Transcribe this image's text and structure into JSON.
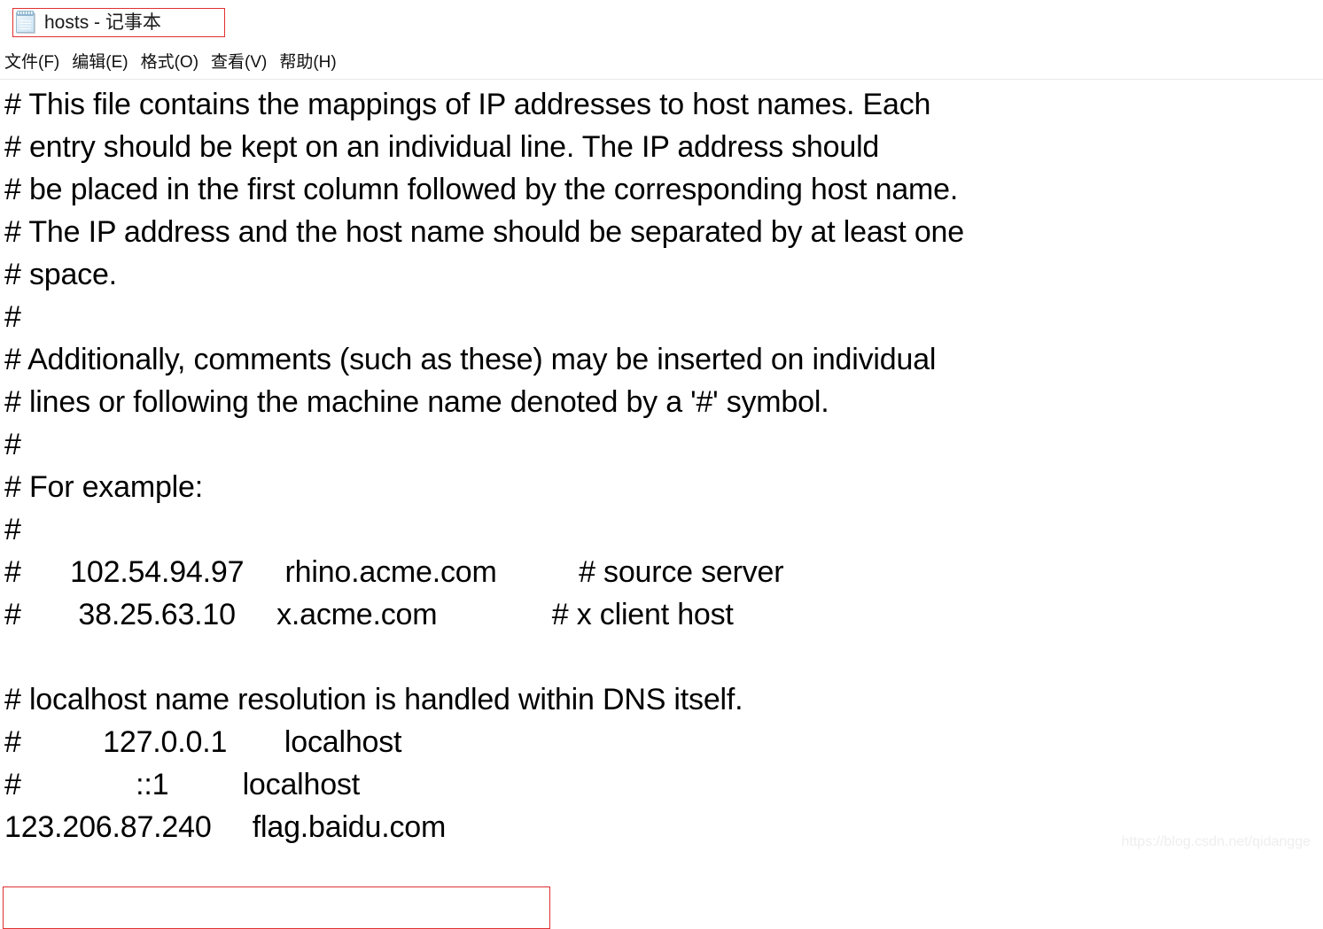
{
  "window": {
    "title": "hosts - 记事本",
    "icon": "notepad-icon",
    "title_highlight_color": "#e03030"
  },
  "menubar": {
    "items": [
      {
        "label": "文件(F)"
      },
      {
        "label": "编辑(E)"
      },
      {
        "label": "格式(O)"
      },
      {
        "label": "查看(V)"
      },
      {
        "label": "帮助(H)"
      }
    ]
  },
  "document": {
    "filename": "hosts",
    "lines": [
      "# This file contains the mappings of IP addresses to host names. Each",
      "# entry should be kept on an individual line. The IP address should",
      "# be placed in the first column followed by the corresponding host name.",
      "# The IP address and the host name should be separated by at least one",
      "# space.",
      "#",
      "# Additionally, comments (such as these) may be inserted on individual",
      "# lines or following the machine name denoted by a '#' symbol.",
      "#",
      "# For example:",
      "#",
      "#      102.54.94.97     rhino.acme.com          # source server",
      "#       38.25.63.10     x.acme.com              # x client host",
      "",
      "# localhost name resolution is handled within DNS itself.",
      "#          127.0.0.1       localhost",
      "#              ::1         localhost",
      "123.206.87.240     flag.baidu.com"
    ],
    "text": "# This file contains the mappings of IP addresses to host names. Each\n# entry should be kept on an individual line. The IP address should\n# be placed in the first column followed by the corresponding host name.\n# The IP address and the host name should be separated by at least one\n# space.\n#\n# Additionally, comments (such as these) may be inserted on individual\n# lines or following the machine name denoted by a '#' symbol.\n#\n# For example:\n#\n#      102.54.94.97     rhino.acme.com          # source server\n#       38.25.63.10     x.acme.com              # x client host\n\n# localhost name resolution is handled within DNS itself.\n#          127.0.0.1       localhost\n#              ::1         localhost\n123.206.87.240     flag.baidu.com"
  },
  "annotations": {
    "flag_entry": "123.206.87.240     flag.baidu.com",
    "highlight_color": "#e03030"
  },
  "watermark": {
    "text": "https://blog.csdn.net/qidangge"
  }
}
